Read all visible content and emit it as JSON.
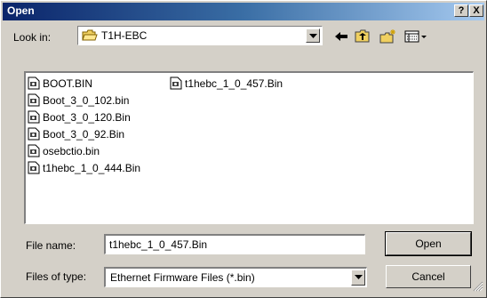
{
  "window": {
    "title": "Open",
    "help_label": "?",
    "close_label": "X"
  },
  "look_in": {
    "label": "Look in:",
    "value": "T1H-EBC",
    "icon": "folder-open-icon"
  },
  "toolbar": [
    "back-arrow-icon",
    "up-one-level-icon",
    "new-folder-icon",
    "views-menu-icon"
  ],
  "files": [
    "BOOT.BIN",
    "Boot_3_0_102.bin",
    "Boot_3_0_120.Bin",
    "Boot_3_0_92.Bin",
    "osebctio.bin",
    "t1hebc_1_0_444.Bin",
    "t1hebc_1_0_457.Bin"
  ],
  "file_name": {
    "label": "File name:",
    "value": "t1hebc_1_0_457.Bin"
  },
  "file_type": {
    "label": "Files of type:",
    "value": "Ethernet Firmware Files (*.bin)"
  },
  "buttons": {
    "open": "Open",
    "cancel": "Cancel"
  },
  "colors": {
    "titlebar_start": "#0a246a",
    "titlebar_end": "#a6caf0",
    "face": "#d4d0c8"
  }
}
